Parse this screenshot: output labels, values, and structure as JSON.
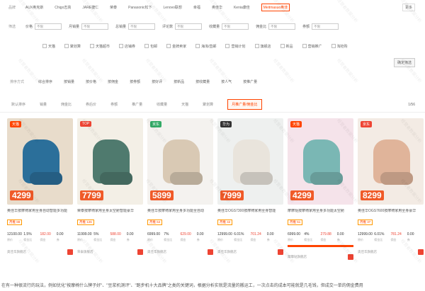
{
  "brand_row": {
    "label": "品牌",
    "brands": [
      "AUX奥克斯",
      "Chigo志高",
      "JARE捷仁",
      "荣泰",
      "Panasonic松下",
      "Lenovo联想",
      "幸福",
      "奥佳华",
      "Kenia康佳",
      "Meitmasuo奥佳"
    ],
    "highlight_index": 9,
    "more_label": "更多"
  },
  "filter_row": {
    "label": "筛选",
    "fields": [
      {
        "label": "价格",
        "value": "不限"
      },
      {
        "label": "月销量",
        "value": "不限"
      },
      {
        "label": "总销量",
        "value": "不限"
      },
      {
        "label": "评论数",
        "value": "不限"
      },
      {
        "label": "收藏量",
        "value": "不限"
      },
      {
        "label": "佣金比",
        "value": "不限"
      },
      {
        "label": "券额",
        "value": "不限"
      }
    ]
  },
  "checks": [
    "天猫",
    "聚划算",
    "天猫超市",
    "店铺券",
    "包邮",
    "金牌卖家",
    "海淘/直邮",
    "营销计划",
    "旗舰店",
    "新品",
    "营销推广",
    "淘抢购"
  ],
  "apply_label": "确定筛选",
  "sort_row": {
    "label": "排序方式",
    "items": [
      "综合排序",
      "按销量",
      "按价格",
      "按佣金",
      "按券额",
      "按好评",
      "按新品",
      "按收藏量",
      "按人气",
      "按推广量"
    ]
  },
  "tabs": {
    "items": [
      "默认排序",
      "销量",
      "佣金比",
      "券后价",
      "券额",
      "推广量",
      "收藏量",
      "天猫",
      "聚划算",
      "月推广量/佣金比"
    ],
    "active_index": 9,
    "page": "1/56"
  },
  "cards": [
    {
      "tag": "天猫",
      "price": "4299",
      "title": "奥佳华按摩椅家用全身自动智能多功能",
      "hot": "月推 88",
      "stats": [
        "12100.00",
        "1.5%",
        "182.00",
        "0.00"
      ],
      "bottom": "奥佳华旗舰店",
      "color": "#2b6f9a",
      "bg": "#e8dccb"
    },
    {
      "tag": "TOP",
      "price": "7799",
      "title": "荣泰按摩椅家用全身太空舱智能豪华",
      "hot": "月推 126",
      "stats": [
        "11999.00",
        "5%",
        "588.00",
        "0.00"
      ],
      "bottom": "荣泰旗舰店",
      "color": "#4f7a6e",
      "bg": "#f3efe6"
    },
    {
      "tag": "京东",
      "price": "5899",
      "title": "奥佳华按摩椅家用全身多功能全自动",
      "hot": "月推 64",
      "stats": [
        "6999.00",
        "7%",
        "629.00",
        "0.00"
      ],
      "bottom": "奥佳华旗舰店",
      "color": "#d9c9b4",
      "bg": "#f4f2ef"
    },
    {
      "tag": "华为",
      "price": "7999",
      "title": "奥佳华OGS7300按摩椅家用全身智能",
      "hot": "月推 42",
      "stats": [
        "12999.00",
        "6.01%",
        "701.24",
        "0.00"
      ],
      "bottom": "奥佳华旗舰店",
      "color": "#e9e4dc",
      "bg": "#eef0ef"
    },
    {
      "tag": "天猫",
      "price": "4299",
      "title": "摩摩哒按摩椅家用全身多功能太空舱",
      "hot": "月推 51",
      "stats": [
        "6999.00",
        "4%",
        "279.88",
        "0.00"
      ],
      "bottom": "摩摩哒旗舰店",
      "color": "#7ab7b4",
      "bg": "#f5e3ea"
    },
    {
      "tag": "京东",
      "price": "8299",
      "title": "奥佳华OGS7600按摩椅家用全身豪华",
      "hot": "月推 37",
      "stats": [
        "12999.00",
        "6.01%",
        "781.24",
        "0.00"
      ],
      "bottom": "奥佳华旗舰店",
      "color": "#e0b49a",
      "bg": "#f3ebe4"
    }
  ],
  "stat_labels": [
    "原价",
    "佣金比",
    "佣金",
    "券"
  ],
  "footer": "在有一种很流行的玩法，例如优化\"按摩椅什么牌子好\"、\"豆浆机测评\"、\"跑步机十大品牌\"之类的关键词，根据分析实就是流量的搬运工，一次点击的成本可能就是几毛钱，但成交一单的佣金费用",
  "watermark": "经营者数据分析"
}
